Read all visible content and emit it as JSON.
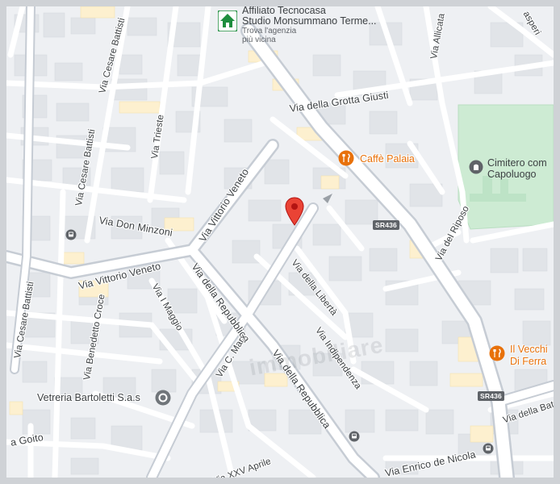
{
  "map": {
    "agency": {
      "name_line1": "Affiliato Tecnocasa",
      "name_line2": "Studio Monsummano Terme...",
      "sub_line1": "Trova l'agenzia",
      "sub_line2": "più vicina"
    },
    "pois": {
      "cafe": "Caffè Palaia",
      "cemetery_line1": "Cimitero com",
      "cemetery_line2": "Capoluogo",
      "vecchio_line1": "Il Vecchi",
      "vecchio_line2": "Di Ferra",
      "vetreria": "Vetreria Bartoletti S.a.s"
    },
    "road_shields": {
      "sr436_a": "SR436",
      "sr436_b": "SR436"
    },
    "streets": {
      "cesare_battisti_top": "Via Cesare Battisti",
      "cesare_battisti_mid": "Via Cesare Battisti",
      "cesare_battisti_bottom": "Via Cesare Battisti",
      "trieste": "Via Trieste",
      "grotta_giusti": "Via della Grotta Giusti",
      "allicata": "Via Allicata",
      "asperi": "asperi",
      "vittorio_veneto_a": "Via Vittorio Veneto",
      "vittorio_veneto_b": "Via Vittorio Veneto",
      "don_minzoni": "Via Don Minzoni",
      "della_liberta": "Via della Libertà",
      "del_riposo": "Via del Riposo",
      "repubblica_a": "Via della Repubblica",
      "repubblica_b": "Via della Repubblica",
      "c_marx": "Via C. Marx",
      "i_maggio": "Via I Maggio",
      "benedetto_croce": "Via Benedetto Croce",
      "indipendenza": "Via Indipendenza",
      "goito": "a Goito",
      "xxv_aprile": "Via XXV Aprile",
      "enrico_de_nicola": "Via Enrico de Nicola",
      "della_bat": "Via della Bat"
    },
    "watermark": "immobiliare"
  }
}
